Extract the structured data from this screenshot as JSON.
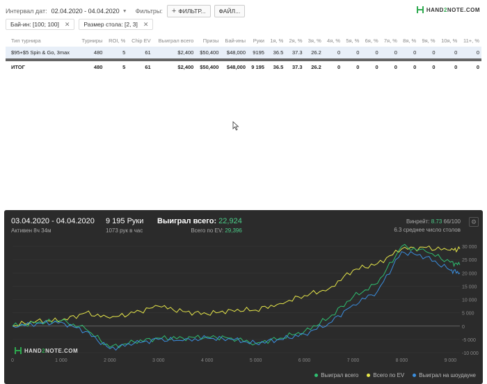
{
  "filters": {
    "interval_label": "Интервал дат:",
    "interval_value": "02.04.2020 - 04.04.2020",
    "filters_label": "Фильтры:",
    "filter_button": "ФИЛЬТР...",
    "file_button": "ФАЙЛ...",
    "logo_text_a": "HAND",
    "logo_text_b": "2",
    "logo_text_c": "NOTE.COM"
  },
  "chips": [
    {
      "label": "Бай-ин: [100; 100]"
    },
    {
      "label": "Размер стола: [2, 3]"
    }
  ],
  "table": {
    "headers": [
      "Тип турнира",
      "Турниры",
      "ROI, %",
      "Chip EV",
      "Выиграл всего",
      "Призы",
      "Бай-ины",
      "Руки",
      "1я, %",
      "2я, %",
      "3я, %",
      "4я, %",
      "5я, %",
      "6я, %",
      "7я, %",
      "8я, %",
      "9я, %",
      "10я, %",
      "11+, %"
    ],
    "row": [
      "$95+$5 Spin & Go, 3max",
      "480",
      "5",
      "61",
      "$2,400",
      "$50,400",
      "$48,000",
      "9195",
      "36.5",
      "37.3",
      "26.2",
      "0",
      "0",
      "0",
      "0",
      "0",
      "0",
      "0",
      "0"
    ],
    "total": [
      "ИТОГ",
      "480",
      "5",
      "61",
      "$2,400",
      "$50,400",
      "$48,000",
      "9 195",
      "36.5",
      "37.3",
      "26.2",
      "0",
      "0",
      "0",
      "0",
      "0",
      "0",
      "0",
      "0"
    ]
  },
  "summary": {
    "dates": "03.04.2020 - 04.04.2020",
    "active": "Активен 8ч 34м",
    "hands": "9 195 Руки",
    "hands_per_hour": "1073 рук в час",
    "won_label": "Выиграл всего:",
    "won_value": "22,924",
    "ev_label": "Всего по EV:",
    "ev_value": "29,396",
    "winrate_label": "Винрейт:",
    "winrate_value": "8.73",
    "winrate_suffix": "66/100",
    "avg_tables": "6.3 среднее число столов"
  },
  "colors": {
    "won": "#2fbf71",
    "ev": "#e8e84a",
    "showdown": "#3b8fe0"
  },
  "chart_data": {
    "type": "line",
    "xlim": [
      0,
      9195
    ],
    "ylim": [
      -10000,
      30000
    ],
    "x_ticks": [
      "0",
      "1 000",
      "2 000",
      "3 000",
      "4 000",
      "5 000",
      "6 000",
      "7 000",
      "8 000",
      "9 000"
    ],
    "y_ticks": [
      "30 000",
      "25 000",
      "20 000",
      "15 000",
      "10 000",
      "5 000",
      "0",
      "-5 000",
      "-10 000"
    ],
    "x": [
      0,
      500,
      1000,
      1500,
      2000,
      2500,
      3000,
      3500,
      4000,
      4500,
      5000,
      5500,
      6000,
      6500,
      7000,
      7500,
      8000,
      8500,
      9000,
      9195
    ],
    "series": [
      {
        "name": "Выиграл всего",
        "values": [
          0,
          1200,
          2000,
          -1000,
          -8000,
          -6000,
          -4500,
          -4500,
          -4000,
          -4500,
          -6500,
          -4500,
          -2000,
          3000,
          11000,
          16000,
          30000,
          28000,
          24000,
          23000
        ]
      },
      {
        "name": "Всего по EV",
        "values": [
          0,
          2000,
          2000,
          5000,
          3000,
          5000,
          7500,
          5500,
          4500,
          6000,
          6000,
          8500,
          11500,
          14000,
          21000,
          23500,
          29000,
          29500,
          28500,
          29000
        ]
      },
      {
        "name": "Выиграл на шоудауне",
        "values": [
          0,
          1000,
          1500,
          -2000,
          -8500,
          -6500,
          -5000,
          -5500,
          -4500,
          -5000,
          -6500,
          -5000,
          -3000,
          1000,
          8000,
          13000,
          28000,
          26000,
          21000,
          20000
        ]
      }
    ]
  }
}
